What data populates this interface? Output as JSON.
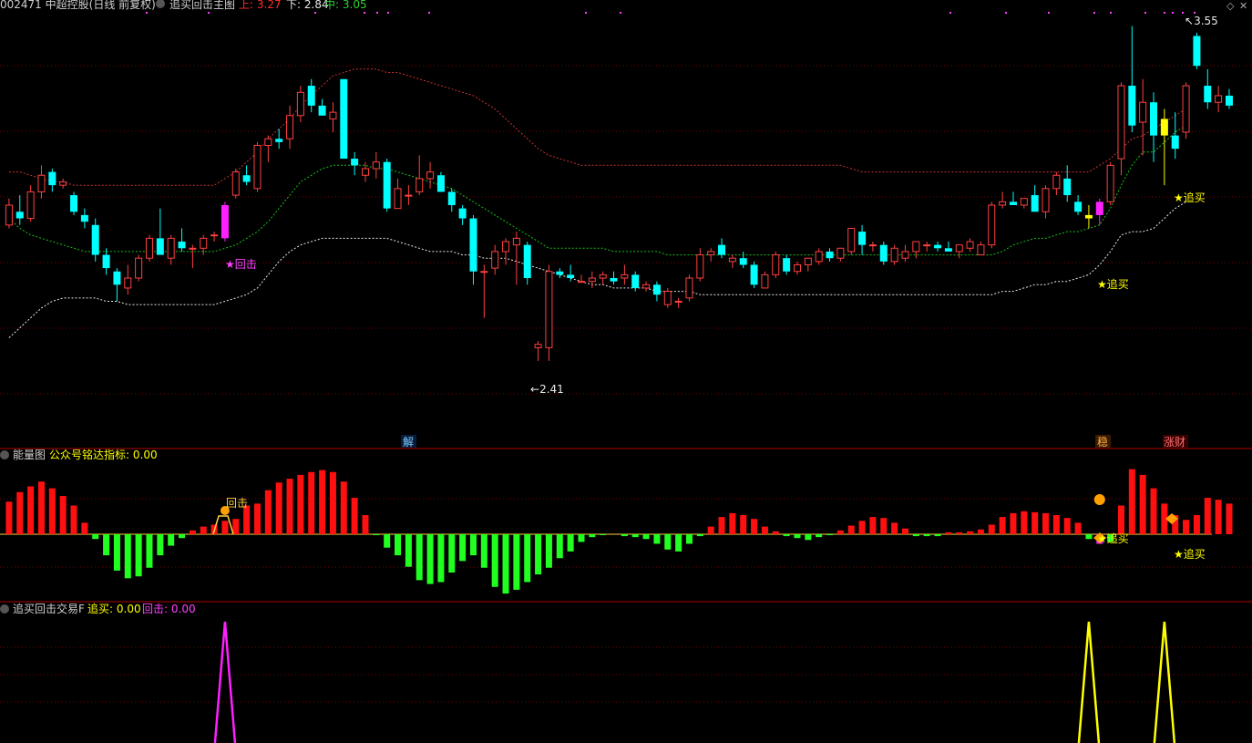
{
  "header": {
    "stock_code": "002471",
    "stock_name": "中超控股",
    "period": "(日线 前复权)",
    "indicator": "追买回击主图",
    "upper_label": "上:",
    "upper_value": "3.27",
    "lower_label": "下:",
    "lower_value": "2.84",
    "mid_label": "中:",
    "mid_value": "3.05"
  },
  "panel2": {
    "title": "能量图",
    "sub_label": "公众号铭达指标:",
    "sub_value": "0.00"
  },
  "panel3": {
    "title": "追买回击交易F",
    "a_label": "追买:",
    "a_value": "0.00",
    "b_label": "回击:",
    "b_value": "0.00"
  },
  "annotations": {
    "high": "3.55",
    "low": "2.41",
    "huiji": "★回击",
    "huiji_short": "回击",
    "zhuimai": "★追买",
    "jie": "解",
    "wen": "稳",
    "zhangcai": "涨财"
  },
  "colors": {
    "background": "#000000",
    "up": "#ff4040",
    "down": "#00ffff",
    "upper_band": "#c83232",
    "mid_band": "#18c018",
    "lower_band": "#e8e8e8",
    "energy_up": "#ff1010",
    "energy_down": "#20ff20",
    "zhuimai": "#ffff00",
    "huiji": "#ff20ff",
    "grid": "#7a0000"
  },
  "chart_data": {
    "type": "candlestick",
    "count": 110,
    "ylim": [
      2.35,
      3.62
    ],
    "candles": [
      {
        "o": 2.98,
        "h": 3.06,
        "l": 2.97,
        "c": 3.04
      },
      {
        "o": 3.02,
        "h": 3.07,
        "l": 2.98,
        "c": 3.0
      },
      {
        "o": 3.0,
        "h": 3.1,
        "l": 2.99,
        "c": 3.08
      },
      {
        "o": 3.08,
        "h": 3.16,
        "l": 3.06,
        "c": 3.13
      },
      {
        "o": 3.14,
        "h": 3.15,
        "l": 3.08,
        "c": 3.1
      },
      {
        "o": 3.1,
        "h": 3.12,
        "l": 3.09,
        "c": 3.11
      },
      {
        "o": 3.07,
        "h": 3.08,
        "l": 3.01,
        "c": 3.02
      },
      {
        "o": 3.01,
        "h": 3.03,
        "l": 2.97,
        "c": 2.99
      },
      {
        "o": 2.98,
        "h": 3.0,
        "l": 2.87,
        "c": 2.89
      },
      {
        "o": 2.89,
        "h": 2.91,
        "l": 2.83,
        "c": 2.85
      },
      {
        "o": 2.84,
        "h": 2.85,
        "l": 2.75,
        "c": 2.8
      },
      {
        "o": 2.79,
        "h": 2.86,
        "l": 2.77,
        "c": 2.82
      },
      {
        "o": 2.82,
        "h": 2.89,
        "l": 2.81,
        "c": 2.88
      },
      {
        "o": 2.88,
        "h": 2.95,
        "l": 2.87,
        "c": 2.94
      },
      {
        "o": 2.94,
        "h": 3.03,
        "l": 2.9,
        "c": 2.89
      },
      {
        "o": 2.88,
        "h": 2.95,
        "l": 2.86,
        "c": 2.94
      },
      {
        "o": 2.93,
        "h": 2.97,
        "l": 2.9,
        "c": 2.91
      },
      {
        "o": 2.91,
        "h": 2.92,
        "l": 2.85,
        "c": 2.91
      },
      {
        "o": 2.91,
        "h": 2.95,
        "l": 2.89,
        "c": 2.94
      },
      {
        "o": 2.95,
        "h": 2.96,
        "l": 2.93,
        "c": 2.95
      },
      {
        "o": 2.94,
        "h": 3.05,
        "l": 2.93,
        "c": 3.04
      },
      {
        "o": 3.07,
        "h": 3.15,
        "l": 3.06,
        "c": 3.14
      },
      {
        "o": 3.13,
        "h": 3.16,
        "l": 3.1,
        "c": 3.11
      },
      {
        "o": 3.09,
        "h": 3.23,
        "l": 3.08,
        "c": 3.22
      },
      {
        "o": 3.22,
        "h": 3.25,
        "l": 3.17,
        "c": 3.24
      },
      {
        "o": 3.24,
        "h": 3.27,
        "l": 3.21,
        "c": 3.23
      },
      {
        "o": 3.24,
        "h": 3.34,
        "l": 3.21,
        "c": 3.31
      },
      {
        "o": 3.31,
        "h": 3.4,
        "l": 3.29,
        "c": 3.38
      },
      {
        "o": 3.4,
        "h": 3.42,
        "l": 3.32,
        "c": 3.34
      },
      {
        "o": 3.34,
        "h": 3.36,
        "l": 3.31,
        "c": 3.31
      },
      {
        "o": 3.3,
        "h": 3.35,
        "l": 3.26,
        "c": 3.32
      },
      {
        "o": 3.42,
        "h": 3.42,
        "l": 3.18,
        "c": 3.18
      },
      {
        "o": 3.18,
        "h": 3.2,
        "l": 3.13,
        "c": 3.16
      },
      {
        "o": 3.13,
        "h": 3.17,
        "l": 3.11,
        "c": 3.15
      },
      {
        "o": 3.15,
        "h": 3.2,
        "l": 3.12,
        "c": 3.17
      },
      {
        "o": 3.17,
        "h": 3.18,
        "l": 3.02,
        "c": 3.03
      },
      {
        "o": 3.03,
        "h": 3.12,
        "l": 3.03,
        "c": 3.09
      },
      {
        "o": 3.07,
        "h": 3.1,
        "l": 3.04,
        "c": 3.07
      },
      {
        "o": 3.08,
        "h": 3.19,
        "l": 3.07,
        "c": 3.12
      },
      {
        "o": 3.12,
        "h": 3.17,
        "l": 3.09,
        "c": 3.14
      },
      {
        "o": 3.13,
        "h": 3.14,
        "l": 3.08,
        "c": 3.08
      },
      {
        "o": 3.08,
        "h": 3.09,
        "l": 3.02,
        "c": 3.04
      },
      {
        "o": 3.03,
        "h": 3.04,
        "l": 2.98,
        "c": 3.0
      },
      {
        "o": 3.0,
        "h": 3.01,
        "l": 2.8,
        "c": 2.84
      },
      {
        "o": 2.84,
        "h": 2.86,
        "l": 2.7,
        "c": 2.84
      },
      {
        "o": 2.85,
        "h": 2.92,
        "l": 2.83,
        "c": 2.9
      },
      {
        "o": 2.9,
        "h": 2.94,
        "l": 2.86,
        "c": 2.93
      },
      {
        "o": 2.92,
        "h": 2.96,
        "l": 2.8,
        "c": 2.94
      },
      {
        "o": 2.92,
        "h": 2.93,
        "l": 2.8,
        "c": 2.82
      },
      {
        "o": 2.61,
        "h": 2.63,
        "l": 2.57,
        "c": 2.62
      },
      {
        "o": 2.61,
        "h": 2.86,
        "l": 2.57,
        "c": 2.84
      },
      {
        "o": 2.84,
        "h": 2.85,
        "l": 2.82,
        "c": 2.83
      },
      {
        "o": 2.83,
        "h": 2.86,
        "l": 2.81,
        "c": 2.82
      },
      {
        "o": 2.81,
        "h": 2.83,
        "l": 2.81,
        "c": 2.81
      },
      {
        "o": 2.81,
        "h": 2.84,
        "l": 2.79,
        "c": 2.82
      },
      {
        "o": 2.82,
        "h": 2.84,
        "l": 2.8,
        "c": 2.83
      },
      {
        "o": 2.82,
        "h": 2.84,
        "l": 2.8,
        "c": 2.81
      },
      {
        "o": 2.82,
        "h": 2.86,
        "l": 2.8,
        "c": 2.83
      },
      {
        "o": 2.83,
        "h": 2.84,
        "l": 2.78,
        "c": 2.79
      },
      {
        "o": 2.79,
        "h": 2.81,
        "l": 2.78,
        "c": 2.8
      },
      {
        "o": 2.8,
        "h": 2.81,
        "l": 2.75,
        "c": 2.77
      },
      {
        "o": 2.74,
        "h": 2.79,
        "l": 2.73,
        "c": 2.78
      },
      {
        "o": 2.75,
        "h": 2.76,
        "l": 2.73,
        "c": 2.75
      },
      {
        "o": 2.76,
        "h": 2.83,
        "l": 2.75,
        "c": 2.82
      },
      {
        "o": 2.82,
        "h": 2.91,
        "l": 2.81,
        "c": 2.89
      },
      {
        "o": 2.89,
        "h": 2.91,
        "l": 2.87,
        "c": 2.9
      },
      {
        "o": 2.92,
        "h": 2.94,
        "l": 2.88,
        "c": 2.89
      },
      {
        "o": 2.87,
        "h": 2.89,
        "l": 2.85,
        "c": 2.88
      },
      {
        "o": 2.88,
        "h": 2.9,
        "l": 2.85,
        "c": 2.86
      },
      {
        "o": 2.86,
        "h": 2.87,
        "l": 2.79,
        "c": 2.8
      },
      {
        "o": 2.79,
        "h": 2.84,
        "l": 2.79,
        "c": 2.83
      },
      {
        "o": 2.83,
        "h": 2.9,
        "l": 2.82,
        "c": 2.89
      },
      {
        "o": 2.88,
        "h": 2.89,
        "l": 2.83,
        "c": 2.84
      },
      {
        "o": 2.84,
        "h": 2.87,
        "l": 2.83,
        "c": 2.86
      },
      {
        "o": 2.86,
        "h": 2.88,
        "l": 2.84,
        "c": 2.88
      },
      {
        "o": 2.87,
        "h": 2.91,
        "l": 2.86,
        "c": 2.9
      },
      {
        "o": 2.9,
        "h": 2.91,
        "l": 2.87,
        "c": 2.88
      },
      {
        "o": 2.88,
        "h": 2.91,
        "l": 2.87,
        "c": 2.91
      },
      {
        "o": 2.9,
        "h": 2.97,
        "l": 2.89,
        "c": 2.97
      },
      {
        "o": 2.96,
        "h": 2.98,
        "l": 2.89,
        "c": 2.92
      },
      {
        "o": 2.92,
        "h": 2.93,
        "l": 2.9,
        "c": 2.92
      },
      {
        "o": 2.92,
        "h": 2.93,
        "l": 2.86,
        "c": 2.87
      },
      {
        "o": 2.87,
        "h": 2.92,
        "l": 2.86,
        "c": 2.91
      },
      {
        "o": 2.88,
        "h": 2.92,
        "l": 2.87,
        "c": 2.9
      },
      {
        "o": 2.9,
        "h": 2.93,
        "l": 2.88,
        "c": 2.93
      },
      {
        "o": 2.92,
        "h": 2.93,
        "l": 2.9,
        "c": 2.92
      },
      {
        "o": 2.92,
        "h": 2.93,
        "l": 2.9,
        "c": 2.91
      },
      {
        "o": 2.91,
        "h": 2.93,
        "l": 2.9,
        "c": 2.9
      },
      {
        "o": 2.9,
        "h": 2.92,
        "l": 2.88,
        "c": 2.92
      },
      {
        "o": 2.91,
        "h": 2.94,
        "l": 2.9,
        "c": 2.93
      },
      {
        "o": 2.89,
        "h": 2.93,
        "l": 2.89,
        "c": 2.92
      },
      {
        "o": 2.92,
        "h": 3.05,
        "l": 2.91,
        "c": 3.04
      },
      {
        "o": 3.04,
        "h": 3.08,
        "l": 3.03,
        "c": 3.05
      },
      {
        "o": 3.05,
        "h": 3.08,
        "l": 3.04,
        "c": 3.04
      },
      {
        "o": 3.04,
        "h": 3.06,
        "l": 3.03,
        "c": 3.06
      },
      {
        "o": 3.07,
        "h": 3.1,
        "l": 3.06,
        "c": 3.02
      },
      {
        "o": 3.02,
        "h": 3.1,
        "l": 3.0,
        "c": 3.09
      },
      {
        "o": 3.09,
        "h": 3.14,
        "l": 3.07,
        "c": 3.13
      },
      {
        "o": 3.12,
        "h": 3.16,
        "l": 3.05,
        "c": 3.07
      },
      {
        "o": 3.05,
        "h": 3.07,
        "l": 3.01,
        "c": 3.02
      },
      {
        "o": 3.01,
        "h": 3.04,
        "l": 2.97,
        "c": 3.0
      },
      {
        "o": 3.01,
        "h": 3.06,
        "l": 2.98,
        "c": 3.05
      },
      {
        "o": 3.05,
        "h": 3.17,
        "l": 3.04,
        "c": 3.16
      },
      {
        "o": 3.18,
        "h": 3.41,
        "l": 3.13,
        "c": 3.4
      },
      {
        "o": 3.4,
        "h": 3.58,
        "l": 3.26,
        "c": 3.28
      },
      {
        "o": 3.29,
        "h": 3.42,
        "l": 3.19,
        "c": 3.35
      },
      {
        "o": 3.35,
        "h": 3.38,
        "l": 3.17,
        "c": 3.25
      },
      {
        "o": 3.25,
        "h": 3.33,
        "l": 3.1,
        "c": 3.3
      },
      {
        "o": 3.25,
        "h": 3.32,
        "l": 3.18,
        "c": 3.21
      },
      {
        "o": 3.26,
        "h": 3.41,
        "l": 3.24,
        "c": 3.4
      },
      {
        "o": 3.55,
        "h": 3.56,
        "l": 3.45,
        "c": 3.46
      },
      {
        "o": 3.4,
        "h": 3.45,
        "l": 3.33,
        "c": 3.35
      },
      {
        "o": 3.35,
        "h": 3.4,
        "l": 3.32,
        "c": 3.37
      },
      {
        "o": 3.37,
        "h": 3.39,
        "l": 3.33,
        "c": 3.34
      }
    ],
    "upper_band": [
      3.14,
      3.14,
      3.13,
      3.12,
      3.11,
      3.11,
      3.1,
      3.1,
      3.1,
      3.1,
      3.1,
      3.1,
      3.1,
      3.1,
      3.1,
      3.1,
      3.1,
      3.1,
      3.1,
      3.1,
      3.12,
      3.14,
      3.17,
      3.2,
      3.24,
      3.27,
      3.3,
      3.34,
      3.37,
      3.4,
      3.43,
      3.44,
      3.45,
      3.45,
      3.45,
      3.44,
      3.44,
      3.43,
      3.42,
      3.41,
      3.4,
      3.39,
      3.38,
      3.37,
      3.35,
      3.33,
      3.3,
      3.27,
      3.24,
      3.21,
      3.19,
      3.18,
      3.17,
      3.16,
      3.16,
      3.16,
      3.16,
      3.16,
      3.16,
      3.16,
      3.16,
      3.16,
      3.16,
      3.16,
      3.16,
      3.16,
      3.16,
      3.16,
      3.16,
      3.16,
      3.16,
      3.16,
      3.16,
      3.16,
      3.16,
      3.16,
      3.16,
      3.16,
      3.15,
      3.14,
      3.14,
      3.14,
      3.14,
      3.14,
      3.14,
      3.14,
      3.14,
      3.14,
      3.14,
      3.14,
      3.14,
      3.14,
      3.14,
      3.14,
      3.14,
      3.14,
      3.14,
      3.14,
      3.14,
      3.14,
      3.14,
      3.16,
      3.18,
      3.21,
      3.24,
      3.25,
      3.27,
      3.29,
      3.31,
      3.33
    ],
    "mid_band": [
      3.0,
      2.97,
      2.95,
      2.94,
      2.93,
      2.92,
      2.91,
      2.9,
      2.9,
      2.9,
      2.9,
      2.9,
      2.9,
      2.9,
      2.9,
      2.9,
      2.9,
      2.9,
      2.9,
      2.9,
      2.91,
      2.92,
      2.94,
      2.96,
      2.99,
      3.03,
      3.07,
      3.11,
      3.13,
      3.15,
      3.16,
      3.16,
      3.16,
      3.16,
      3.15,
      3.15,
      3.14,
      3.13,
      3.12,
      3.11,
      3.1,
      3.09,
      3.07,
      3.05,
      3.03,
      3.01,
      2.99,
      2.97,
      2.95,
      2.93,
      2.91,
      2.91,
      2.91,
      2.91,
      2.91,
      2.91,
      2.9,
      2.9,
      2.9,
      2.9,
      2.9,
      2.89,
      2.89,
      2.89,
      2.89,
      2.89,
      2.89,
      2.89,
      2.89,
      2.89,
      2.89,
      2.89,
      2.89,
      2.89,
      2.89,
      2.89,
      2.89,
      2.89,
      2.89,
      2.89,
      2.89,
      2.89,
      2.89,
      2.89,
      2.89,
      2.89,
      2.89,
      2.89,
      2.89,
      2.89,
      2.89,
      2.89,
      2.9,
      2.92,
      2.93,
      2.94,
      2.94,
      2.95,
      2.96,
      2.96,
      2.97,
      2.98,
      3.03,
      3.1,
      3.16,
      3.2,
      3.2,
      3.23,
      3.26,
      3.28
    ],
    "lower_band": [
      2.64,
      2.67,
      2.7,
      2.73,
      2.75,
      2.76,
      2.76,
      2.76,
      2.76,
      2.75,
      2.75,
      2.74,
      2.74,
      2.74,
      2.74,
      2.74,
      2.74,
      2.74,
      2.74,
      2.74,
      2.75,
      2.76,
      2.77,
      2.79,
      2.83,
      2.87,
      2.9,
      2.92,
      2.93,
      2.94,
      2.94,
      2.94,
      2.94,
      2.94,
      2.94,
      2.94,
      2.93,
      2.92,
      2.91,
      2.9,
      2.9,
      2.9,
      2.89,
      2.89,
      2.88,
      2.88,
      2.88,
      2.87,
      2.86,
      2.85,
      2.84,
      2.83,
      2.82,
      2.81,
      2.8,
      2.8,
      2.79,
      2.79,
      2.79,
      2.79,
      2.78,
      2.78,
      2.78,
      2.78,
      2.77,
      2.77,
      2.77,
      2.77,
      2.77,
      2.77,
      2.77,
      2.77,
      2.77,
      2.77,
      2.77,
      2.77,
      2.77,
      2.77,
      2.77,
      2.77,
      2.77,
      2.77,
      2.77,
      2.77,
      2.77,
      2.77,
      2.77,
      2.77,
      2.77,
      2.77,
      2.77,
      2.77,
      2.78,
      2.78,
      2.79,
      2.8,
      2.8,
      2.81,
      2.81,
      2.82,
      2.83,
      2.86,
      2.9,
      2.95,
      2.96,
      2.96,
      2.97,
      3.0,
      3.03,
      3.05
    ],
    "energy": [
      34,
      44,
      50,
      55,
      48,
      40,
      30,
      12,
      -5,
      -22,
      -38,
      -46,
      -44,
      -35,
      -22,
      -12,
      -4,
      4,
      8,
      10,
      14,
      16,
      30,
      32,
      46,
      54,
      58,
      62,
      65,
      67,
      65,
      55,
      38,
      20,
      -1,
      -14,
      -22,
      -34,
      -48,
      -52,
      -50,
      -40,
      -28,
      -22,
      -35,
      -55,
      -62,
      -58,
      -50,
      -42,
      -35,
      -25,
      -18,
      -8,
      -3,
      -1,
      0,
      -2,
      -3,
      -5,
      -10,
      -16,
      -18,
      -10,
      -2,
      8,
      18,
      22,
      20,
      16,
      8,
      3,
      -2,
      -4,
      -6,
      -3,
      -1,
      4,
      9,
      14,
      18,
      17,
      12,
      6,
      -2,
      -2,
      -2,
      2,
      2,
      3,
      5,
      10,
      18,
      22,
      24,
      23,
      22,
      20,
      17,
      12,
      -5,
      -10,
      -8,
      30,
      68,
      62,
      48,
      32,
      20,
      15,
      20,
      38,
      36,
      32
    ],
    "zhuimai_peaks": [
      100,
      107
    ],
    "huiji_peaks": [
      20
    ]
  }
}
